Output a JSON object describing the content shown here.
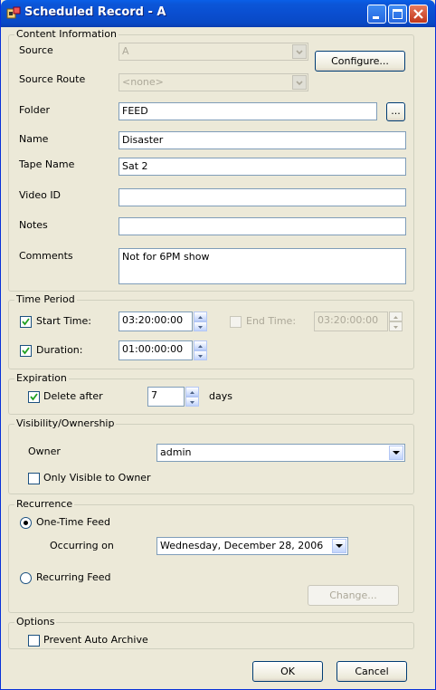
{
  "window": {
    "title": "Scheduled Record - A",
    "icons": {
      "app": "app-icon",
      "minimize": "minimize-icon",
      "maximize": "maximize-icon",
      "close": "close-icon"
    }
  },
  "content_information": {
    "legend": "Content Information",
    "source_label": "Source",
    "source_value": "A",
    "configure_label": "Configure...",
    "source_route_label": "Source Route",
    "source_route_value": "<none>",
    "folder_label": "Folder",
    "folder_value": "FEED",
    "browse_label": "...",
    "name_label": "Name",
    "name_value": "Disaster",
    "tape_name_label": "Tape Name",
    "tape_name_value": "Sat 2",
    "video_id_label": "Video ID",
    "video_id_value": "",
    "notes_label": "Notes",
    "notes_value": "",
    "comments_label": "Comments",
    "comments_value": "Not for 6PM show"
  },
  "time_period": {
    "legend": "Time Period",
    "start_time_label": "Start Time:",
    "start_time_checked": true,
    "start_time_value": "03:20:00:00",
    "end_time_label": "End Time:",
    "end_time_checked": false,
    "end_time_value": "03:20:00:00",
    "duration_label": "Duration:",
    "duration_checked": true,
    "duration_value": "01:00:00:00"
  },
  "expiration": {
    "legend": "Expiration",
    "delete_after_label": "Delete after",
    "delete_after_checked": true,
    "days_value": "7",
    "days_label": "days"
  },
  "visibility": {
    "legend": "Visibility/Ownership",
    "owner_label": "Owner",
    "owner_value": "admin",
    "only_visible_label": "Only Visible to Owner",
    "only_visible_checked": false
  },
  "recurrence": {
    "legend": "Recurrence",
    "one_time_label": "One-Time Feed",
    "one_time_selected": true,
    "occurring_on_label": "Occurring on",
    "occurring_on_value": "Wednesday, December 28, 2006",
    "recurring_label": "Recurring Feed",
    "recurring_selected": false,
    "change_label": "Change..."
  },
  "options": {
    "legend": "Options",
    "prevent_archive_label": "Prevent Auto Archive",
    "prevent_archive_checked": false
  },
  "footer": {
    "ok_label": "OK",
    "cancel_label": "Cancel"
  }
}
